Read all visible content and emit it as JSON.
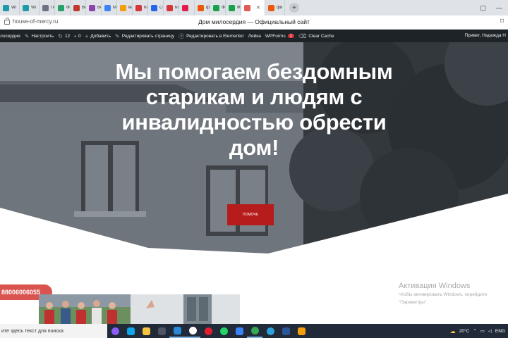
{
  "browser": {
    "tabs": [
      {
        "label": "Wi",
        "color": "#1e9aa6"
      },
      {
        "label": "Wi",
        "color": "#1e9aa6"
      },
      {
        "label": "По",
        "color": "#6b7280"
      },
      {
        "label": "Фо",
        "color": "#26a269"
      },
      {
        "label": "Ве",
        "color": "#c0392b"
      },
      {
        "label": "Ве",
        "color": "#8e44ad"
      },
      {
        "label": "Mi",
        "color": "#3b82f6"
      },
      {
        "label": "ма",
        "color": "#f59e0b"
      },
      {
        "label": "Ко",
        "color": "#d63638"
      },
      {
        "label": "Сб",
        "color": "#2563eb"
      },
      {
        "label": "Ко",
        "color": "#d63638"
      },
      {
        "label": "",
        "color": "#e11d48"
      },
      {
        "label": "фр",
        "color": "#ea580c"
      },
      {
        "label": "Фо",
        "color": "#16a34a"
      },
      {
        "label": "Фр",
        "color": "#16a34a"
      }
    ],
    "active_tab": {
      "label": "",
      "color": "#e45858"
    },
    "last_tab": {
      "label": "фи",
      "color": "#ea580c"
    },
    "url": "house-of-mercy.ru",
    "page_title": "Дом милосердия — Официальный сайт"
  },
  "wp_admin": {
    "site": "лосердия",
    "customize": "Настроить",
    "updates": "12",
    "comments": "0",
    "add_new": "Добавить",
    "edit_page": "Редактировать страницу",
    "edit_elementor": "Редактировать в Elementor",
    "leika": "Лейка",
    "wpforms": "WPForms",
    "wpforms_badge": "1",
    "clear_cache": "Clear Cache",
    "greeting": "Привет, Надежда Н"
  },
  "hero": {
    "headline": "Мы помогаем бездомным старикам и людям с инвалидностью обрести дом!",
    "donate_label": "ПОМОЧЬ"
  },
  "phone": "88006006055",
  "windows_activation": {
    "title": "Активация Windows",
    "line1": "Чтобы активировать Windows, перейдите",
    "line2": "\"Параметры\"."
  },
  "taskbar": {
    "search_placeholder": "ите здесь текст для поиска",
    "apps": [
      {
        "name": "alice",
        "color": "#8b5cf6"
      },
      {
        "name": "edge",
        "color": "#0ea5e9"
      },
      {
        "name": "explorer",
        "color": "#f5c542"
      },
      {
        "name": "store",
        "color": "#4b5563"
      },
      {
        "name": "mail",
        "color": "#2b88d8"
      },
      {
        "name": "yandex",
        "color": "#ffffff"
      },
      {
        "name": "opera",
        "color": "#e11d2e"
      },
      {
        "name": "whatsapp",
        "color": "#25d366"
      },
      {
        "name": "photos",
        "color": "#3b82f6"
      },
      {
        "name": "chrome",
        "color": "#34a853"
      },
      {
        "name": "telegram",
        "color": "#2aa1da"
      },
      {
        "name": "word",
        "color": "#2b579a"
      },
      {
        "name": "app",
        "color": "#f59e0b"
      }
    ],
    "temperature": "20°C",
    "lang": "ENG"
  }
}
